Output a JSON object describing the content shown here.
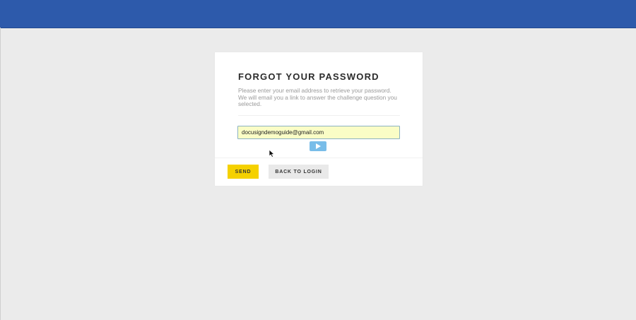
{
  "header": {
    "color": "#2d5aab"
  },
  "forgot_password": {
    "title": "FORGOT YOUR PASSWORD",
    "description": "Please enter your email address to retrieve your password. We will email you a link to answer the challenge question you selected.",
    "email_value": "docusigndemoguide@gmail.com",
    "play_icon": "play-icon",
    "send_label": "SEND",
    "back_label": "BACK TO LOGIN"
  },
  "colors": {
    "accent_send": "#f5d100",
    "input_background": "#fafdc6",
    "play_button": "#79bde9",
    "page_background": "#ebebeb"
  },
  "cursor": {
    "icon": "mouse-pointer-icon"
  }
}
